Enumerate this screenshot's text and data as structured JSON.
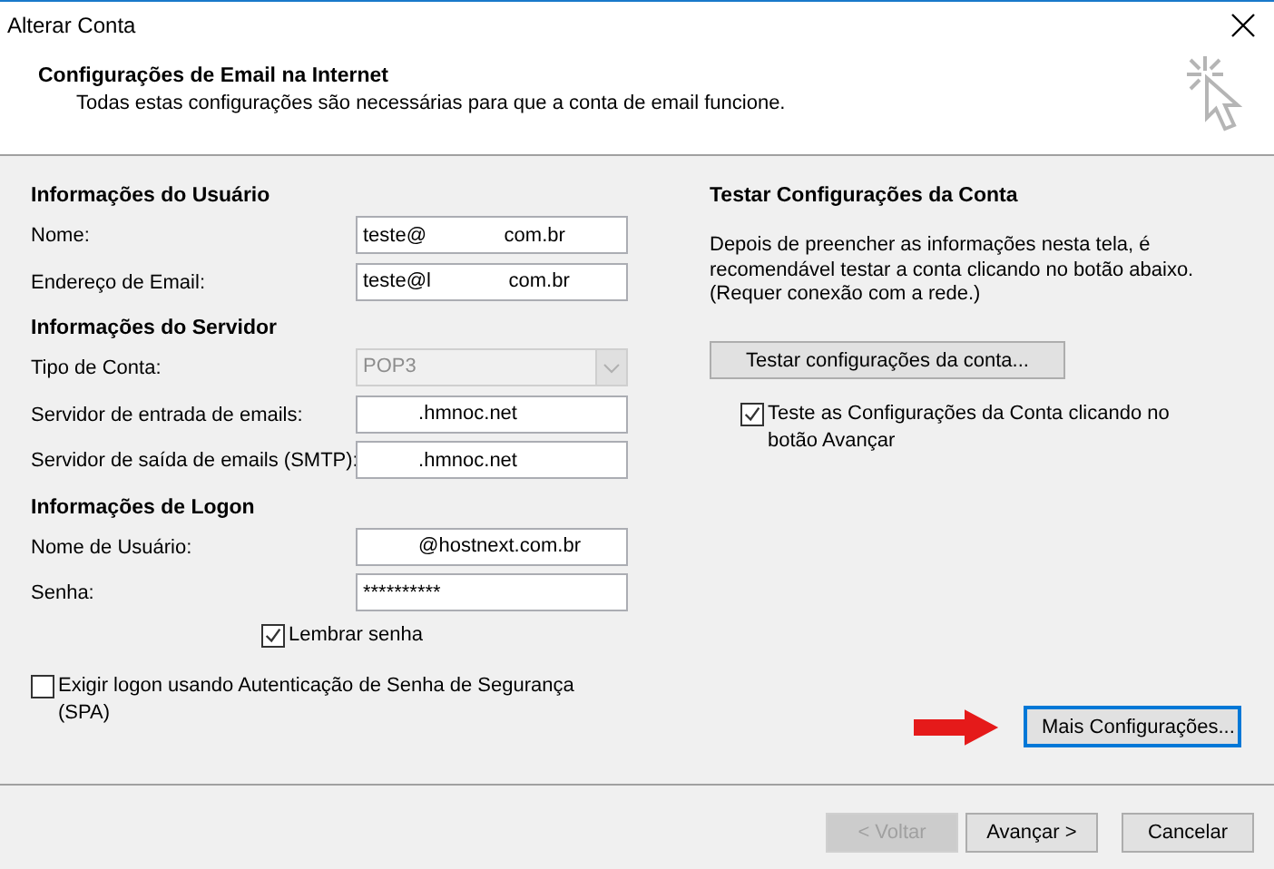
{
  "window": {
    "title": "Alterar Conta"
  },
  "header": {
    "title": "Configurações de Email na Internet",
    "subtitle": "Todas estas configurações são necessárias para que a conta de email funcione."
  },
  "sections": [
    {
      "heading": "Informações do Usuário",
      "fields": [
        {
          "label": "Nome:",
          "value": "teste@              com.br",
          "kind": "text",
          "disabled": false
        },
        {
          "label": "Endereço de Email:",
          "value": "teste@l              com.br",
          "kind": "text",
          "disabled": false
        }
      ]
    },
    {
      "heading": "Informações do Servidor",
      "fields": [
        {
          "label": "Tipo de Conta:",
          "value": "POP3",
          "kind": "select",
          "disabled": true
        },
        {
          "label": "Servidor de entrada de emails:",
          "value": "          .hmnoc.net",
          "kind": "text",
          "disabled": false
        },
        {
          "label": "Servidor de saída de emails (SMTP):",
          "value": "          .hmnoc.net",
          "kind": "text",
          "disabled": false
        }
      ]
    },
    {
      "heading": "Informações de Logon",
      "fields": [
        {
          "label": "Nome de Usuário:",
          "value": "          @hostnext.com.br",
          "kind": "text",
          "disabled": false
        },
        {
          "label": "Senha:",
          "value": "**********",
          "kind": "password",
          "disabled": false
        }
      ]
    }
  ],
  "remember_password": {
    "label": "Lembrar senha",
    "checked": true
  },
  "spa": {
    "label": "Exigir logon usando Autenticação de Senha de Segurança (SPA)",
    "checked": false
  },
  "test_panel": {
    "heading": "Testar Configurações da Conta",
    "description": "Depois de preencher as informações nesta tela, é recomendável testar a conta clicando no botão abaixo. (Requer conexão com a rede.)",
    "button": "Testar configurações da conta...",
    "auto_test": {
      "label": "Teste as Configurações da Conta clicando no botão Avançar",
      "checked": true
    }
  },
  "more_settings": {
    "label": "Mais Configurações...",
    "focused": true
  },
  "buttons": [
    {
      "label": "< Voltar",
      "disabled": true
    },
    {
      "label": "Avançar >",
      "disabled": false
    },
    {
      "label": "Cancelar",
      "disabled": false
    }
  ]
}
